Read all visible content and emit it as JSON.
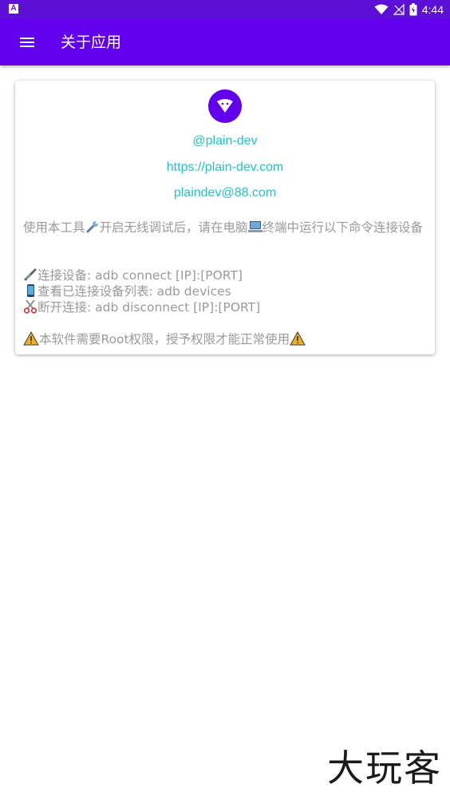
{
  "status_bar": {
    "left_badge": "A",
    "time": "4:44",
    "icons": [
      "wifi-icon",
      "no-signal-icon",
      "battery-icon"
    ]
  },
  "app_bar": {
    "title": "关于应用",
    "menu_icon": "hamburger-icon"
  },
  "about_card": {
    "logo_icon": "android-adb-icon",
    "handle": "@plain-dev",
    "website": "https://plain-dev.com",
    "email": "plaindev@88.com",
    "intro_part1": "使用本工具",
    "intro_part2": "开启无线调试后，请在电脑",
    "intro_part3": "终端中运行以下命令连接设备",
    "commands": [
      {
        "icon": "link-icon",
        "text": "连接设备: adb connect [IP]:[PORT]"
      },
      {
        "icon": "phone-icon",
        "text": "查看已连接设备列表: adb devices"
      },
      {
        "icon": "scissors-icon",
        "text": "断开连接: adb disconnect [IP]:[PORT]"
      }
    ],
    "notice": "本软件需要Root权限，授予权限才能正常使用"
  },
  "watermark": "大玩客",
  "colors": {
    "status_bar": "#5c10d6",
    "app_bar": "#6200ee",
    "link": "#20c4c8",
    "body_text": "#9a9a9a"
  }
}
